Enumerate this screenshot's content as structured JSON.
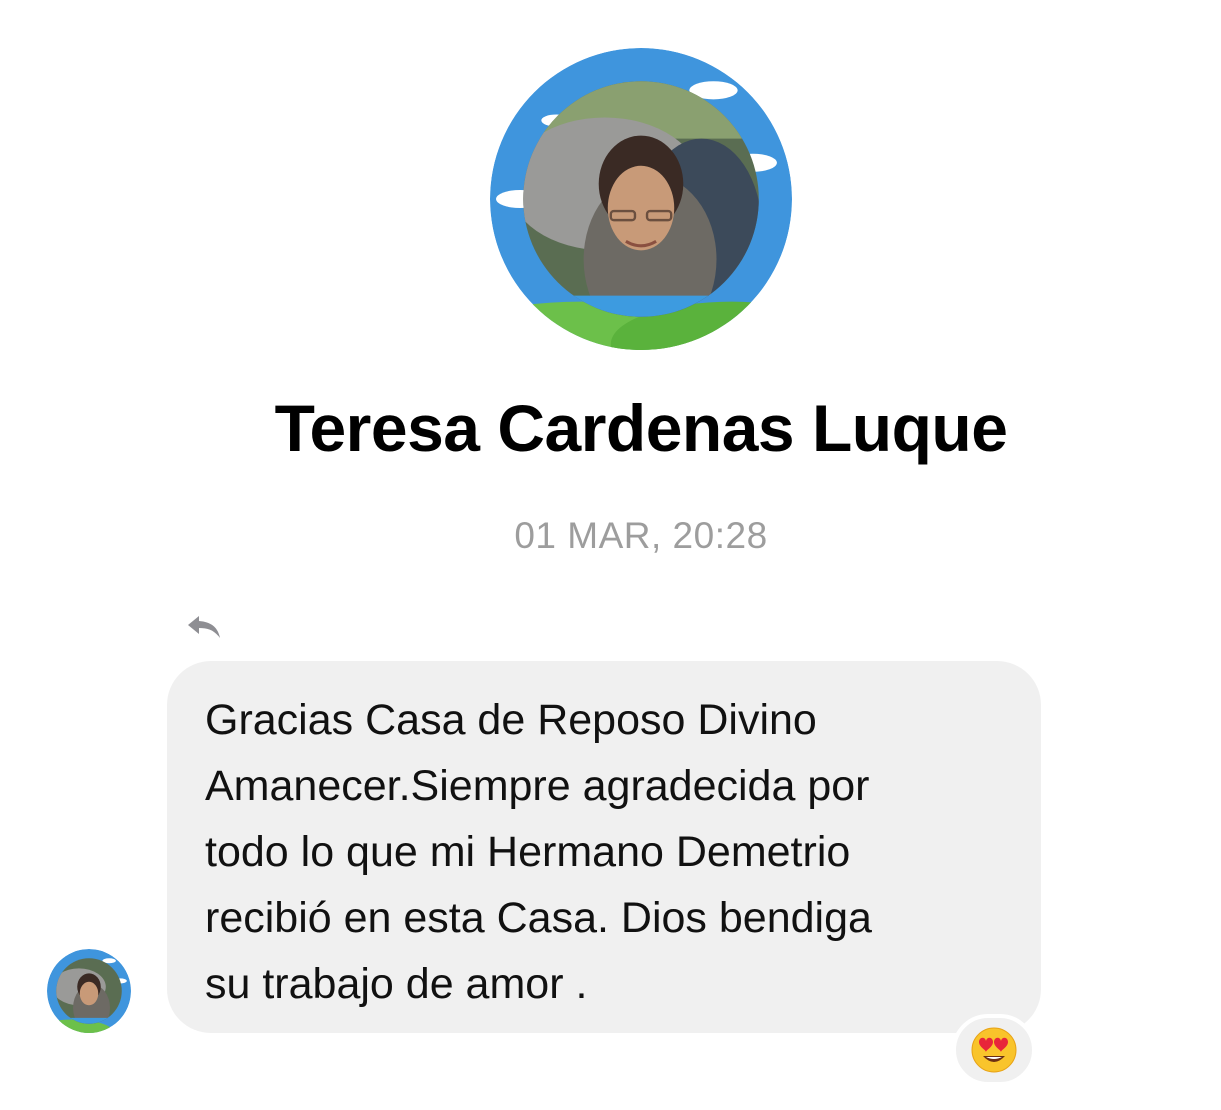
{
  "contact": {
    "name": "Teresa Cardenas Luque",
    "avatar_icon": "profile-photo"
  },
  "conversation": {
    "timestamp": "01 MAR, 20:28"
  },
  "message": {
    "text": "Gracias Casa de Reposo Divino\nAmanecer.Siempre agradecida por\ntodo lo que mi Hermano Demetrio\nrecibió en esta Casa. Dios bendiga\nsu trabajo de amor .",
    "reply_icon": "reply-arrow-icon",
    "reaction": "heart-eyes-emoji"
  },
  "colors": {
    "bubble_background": "#f0f0f0",
    "timestamp_text": "#9d9d9d",
    "avatar_ring": "#4a9be0"
  }
}
